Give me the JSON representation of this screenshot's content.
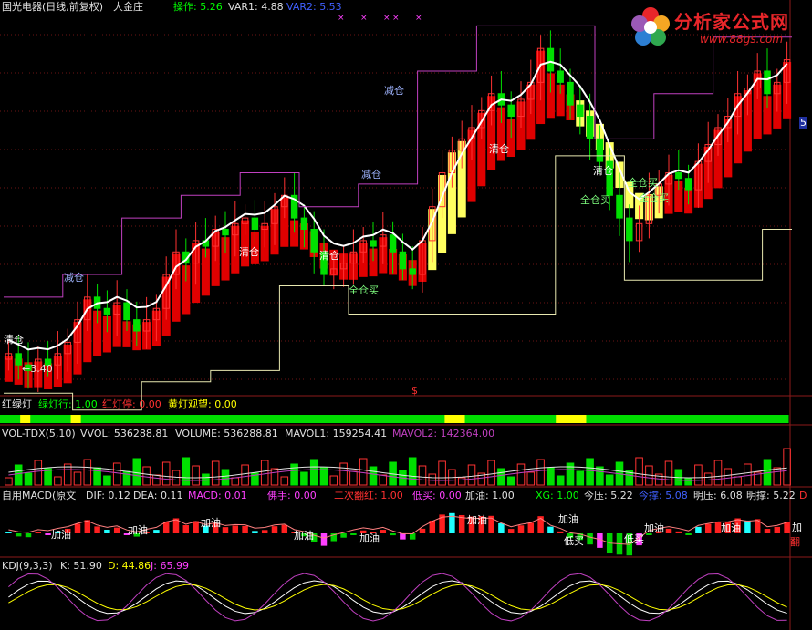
{
  "main_header": {
    "name": "国光电器(日线,前复权)",
    "indicator": "大金庄",
    "op_label": "操作: 5.26",
    "var1_label": "VAR1: 4.88",
    "var2_label": "VAR2: 5.53"
  },
  "logo": {
    "line1": "分析家公式网",
    "line2": "www.88gs.com"
  },
  "right_edge_label": "5",
  "dollar_mark": "$",
  "low_marker": "←3.40",
  "signals": [
    {
      "text": "清仓",
      "color": "#ffffff"
    },
    {
      "text": "减仓",
      "color": "#9fb4ff"
    },
    {
      "text": "清仓",
      "color": "#ffffff"
    },
    {
      "text": "清仓",
      "color": "#ffffff"
    },
    {
      "text": "全仓买",
      "color": "#7fff7f"
    },
    {
      "text": "减仓",
      "color": "#9fb4ff"
    },
    {
      "text": "减仓",
      "color": "#9fb4ff"
    },
    {
      "text": "清仓",
      "color": "#ffffff"
    },
    {
      "text": "清仓",
      "color": "#ffffff"
    },
    {
      "text": "全仓买",
      "color": "#7fff7f"
    },
    {
      "text": "全仓买",
      "color": "#7fff7f"
    },
    {
      "text": "全仓买",
      "color": "#7fff7f"
    }
  ],
  "light_panel": {
    "title": "红绿灯",
    "green": "绿灯行: 1.00",
    "red": "红灯停: 0.00",
    "yellow": "黄灯观望: 0.00"
  },
  "vol_panel": {
    "title": "VOL-TDX(5,10)",
    "vvol": "VVOL: 536288.81",
    "volume": "VOLUME: 536288.81",
    "mavol1": "MAVOL1: 159254.41",
    "mavol2": "MAVOL2: 142364.00"
  },
  "macd_panel": {
    "title": "自用MACD(原文",
    "dif": "DIF: 0.12",
    "dea": "DEA: 0.11",
    "macd": "MACD: 0.01",
    "foshou": "佛手: 0.00",
    "erci": "二次翻红: 1.00",
    "dimai": "低买: 0.00",
    "jiayou": "加油: 1.00",
    "xg": "XG: 1.00",
    "jinya": "今压: 5.22",
    "jincheng": "今撑: 5.08",
    "mingya": "明压: 6.08",
    "mingcheng": "明撑: 5.22",
    "tail": "D",
    "signals": [
      "加油",
      "加油",
      "加油",
      "加油",
      "加油",
      "加油",
      "加油",
      "低买",
      "低买",
      "加油",
      "加油",
      "加"
    ],
    "fan": "翻"
  },
  "kdj_panel": {
    "title": "KDJ(9,3,3)",
    "k": "K: 51.90",
    "d": "D: 44.86",
    "j": "J: 65.99"
  },
  "colors": {
    "up": "#ff3232",
    "down": "#00e000",
    "frame": "#8b1a1a",
    "grid": "#6b1515",
    "white_line": "#ffffff",
    "magenta_line": "#c040c0",
    "support_line": "#e8e8b0",
    "band_red": "#e00000",
    "band_yellow": "#ffff60",
    "macd_red": "#ff2020",
    "macd_green": "#00d000",
    "macd_magenta": "#ff40ff",
    "macd_cyan": "#20ffff",
    "k_line": "#ffffff",
    "d_line": "#ffff00",
    "j_line": "#c040c0"
  },
  "chart_data": {
    "type": "line",
    "symbol": "国光电器",
    "period": "日线",
    "price_range_visible": [
      3.3,
      6.6
    ],
    "min_price_marked": 3.4,
    "indicator_values": {
      "操作": 5.26,
      "VAR1": 4.88,
      "VAR2": 5.53,
      "绿灯行": 1.0,
      "红灯停": 0.0,
      "黄灯观望": 0.0,
      "VVOL": 536288.81,
      "VOLUME": 536288.81,
      "MAVOL1": 159254.41,
      "MAVOL2": 142364.0,
      "DIF": 0.12,
      "DEA": 0.11,
      "MACD": 0.01,
      "佛手": 0.0,
      "二次翻红": 1.0,
      "低买": 0.0,
      "加油": 1.0,
      "XG": 1.0,
      "今压": 5.22,
      "今撑": 5.08,
      "明压": 6.08,
      "明撑": 5.22,
      "K": 51.9,
      "D": 44.86,
      "J": 65.99
    },
    "light_sequence": [
      "G",
      "G",
      "Y",
      "G",
      "G",
      "G",
      "G",
      "Y",
      "G",
      "G",
      "G",
      "G",
      "G",
      "G",
      "G",
      "G",
      "G",
      "G",
      "G",
      "G",
      "G",
      "G",
      "G",
      "G",
      "G",
      "G",
      "G",
      "G",
      "G",
      "G",
      "G",
      "G",
      "G",
      "G",
      "G",
      "G",
      "G",
      "G",
      "G",
      "G",
      "G",
      "G",
      "G",
      "G",
      "Y",
      "Y",
      "G",
      "G",
      "G",
      "G",
      "G",
      "G",
      "G",
      "G",
      "G",
      "Y",
      "Y",
      "Y",
      "G",
      "G",
      "G",
      "G",
      "G",
      "G",
      "G",
      "G",
      "G",
      "G",
      "G",
      "G",
      "G",
      "G",
      "G",
      "G",
      "G",
      "G",
      "G",
      "G"
    ],
    "close": [
      3.6,
      3.5,
      3.45,
      3.55,
      3.5,
      3.6,
      3.7,
      3.9,
      4.1,
      4.0,
      3.95,
      4.05,
      3.9,
      3.8,
      3.9,
      4.0,
      4.3,
      4.5,
      4.4,
      4.6,
      4.55,
      4.7,
      4.65,
      4.75,
      4.8,
      4.7,
      4.75,
      4.9,
      5.0,
      4.8,
      4.7,
      4.5,
      4.3,
      4.35,
      4.4,
      4.5,
      4.6,
      4.55,
      4.65,
      4.5,
      4.35,
      4.3,
      4.6,
      4.9,
      5.2,
      5.4,
      5.5,
      5.6,
      5.75,
      5.9,
      5.8,
      5.7,
      5.85,
      6.0,
      6.3,
      6.1,
      6.0,
      5.8,
      5.7,
      5.5,
      5.3,
      5.0,
      4.8,
      4.6,
      4.75,
      5.0,
      5.1,
      5.2,
      5.15,
      5.05,
      5.3,
      5.45,
      5.6,
      5.7,
      5.9,
      5.95,
      6.1,
      5.9,
      6.0,
      6.2
    ]
  }
}
